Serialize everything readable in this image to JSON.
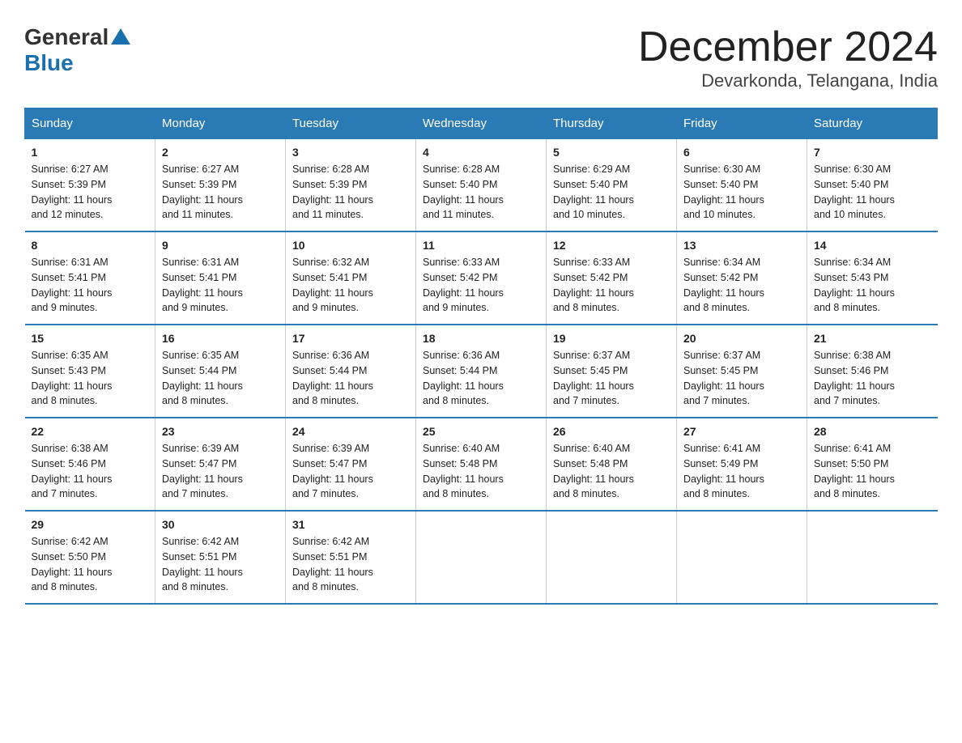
{
  "logo": {
    "general": "General",
    "blue": "Blue"
  },
  "title": {
    "month": "December 2024",
    "location": "Devarkonda, Telangana, India"
  },
  "days_of_week": [
    "Sunday",
    "Monday",
    "Tuesday",
    "Wednesday",
    "Thursday",
    "Friday",
    "Saturday"
  ],
  "weeks": [
    [
      {
        "day": "1",
        "sunrise": "6:27 AM",
        "sunset": "5:39 PM",
        "daylight": "11 hours and 12 minutes."
      },
      {
        "day": "2",
        "sunrise": "6:27 AM",
        "sunset": "5:39 PM",
        "daylight": "11 hours and 11 minutes."
      },
      {
        "day": "3",
        "sunrise": "6:28 AM",
        "sunset": "5:39 PM",
        "daylight": "11 hours and 11 minutes."
      },
      {
        "day": "4",
        "sunrise": "6:28 AM",
        "sunset": "5:40 PM",
        "daylight": "11 hours and 11 minutes."
      },
      {
        "day": "5",
        "sunrise": "6:29 AM",
        "sunset": "5:40 PM",
        "daylight": "11 hours and 10 minutes."
      },
      {
        "day": "6",
        "sunrise": "6:30 AM",
        "sunset": "5:40 PM",
        "daylight": "11 hours and 10 minutes."
      },
      {
        "day": "7",
        "sunrise": "6:30 AM",
        "sunset": "5:40 PM",
        "daylight": "11 hours and 10 minutes."
      }
    ],
    [
      {
        "day": "8",
        "sunrise": "6:31 AM",
        "sunset": "5:41 PM",
        "daylight": "11 hours and 9 minutes."
      },
      {
        "day": "9",
        "sunrise": "6:31 AM",
        "sunset": "5:41 PM",
        "daylight": "11 hours and 9 minutes."
      },
      {
        "day": "10",
        "sunrise": "6:32 AM",
        "sunset": "5:41 PM",
        "daylight": "11 hours and 9 minutes."
      },
      {
        "day": "11",
        "sunrise": "6:33 AM",
        "sunset": "5:42 PM",
        "daylight": "11 hours and 9 minutes."
      },
      {
        "day": "12",
        "sunrise": "6:33 AM",
        "sunset": "5:42 PM",
        "daylight": "11 hours and 8 minutes."
      },
      {
        "day": "13",
        "sunrise": "6:34 AM",
        "sunset": "5:42 PM",
        "daylight": "11 hours and 8 minutes."
      },
      {
        "day": "14",
        "sunrise": "6:34 AM",
        "sunset": "5:43 PM",
        "daylight": "11 hours and 8 minutes."
      }
    ],
    [
      {
        "day": "15",
        "sunrise": "6:35 AM",
        "sunset": "5:43 PM",
        "daylight": "11 hours and 8 minutes."
      },
      {
        "day": "16",
        "sunrise": "6:35 AM",
        "sunset": "5:44 PM",
        "daylight": "11 hours and 8 minutes."
      },
      {
        "day": "17",
        "sunrise": "6:36 AM",
        "sunset": "5:44 PM",
        "daylight": "11 hours and 8 minutes."
      },
      {
        "day": "18",
        "sunrise": "6:36 AM",
        "sunset": "5:44 PM",
        "daylight": "11 hours and 8 minutes."
      },
      {
        "day": "19",
        "sunrise": "6:37 AM",
        "sunset": "5:45 PM",
        "daylight": "11 hours and 7 minutes."
      },
      {
        "day": "20",
        "sunrise": "6:37 AM",
        "sunset": "5:45 PM",
        "daylight": "11 hours and 7 minutes."
      },
      {
        "day": "21",
        "sunrise": "6:38 AM",
        "sunset": "5:46 PM",
        "daylight": "11 hours and 7 minutes."
      }
    ],
    [
      {
        "day": "22",
        "sunrise": "6:38 AM",
        "sunset": "5:46 PM",
        "daylight": "11 hours and 7 minutes."
      },
      {
        "day": "23",
        "sunrise": "6:39 AM",
        "sunset": "5:47 PM",
        "daylight": "11 hours and 7 minutes."
      },
      {
        "day": "24",
        "sunrise": "6:39 AM",
        "sunset": "5:47 PM",
        "daylight": "11 hours and 7 minutes."
      },
      {
        "day": "25",
        "sunrise": "6:40 AM",
        "sunset": "5:48 PM",
        "daylight": "11 hours and 8 minutes."
      },
      {
        "day": "26",
        "sunrise": "6:40 AM",
        "sunset": "5:48 PM",
        "daylight": "11 hours and 8 minutes."
      },
      {
        "day": "27",
        "sunrise": "6:41 AM",
        "sunset": "5:49 PM",
        "daylight": "11 hours and 8 minutes."
      },
      {
        "day": "28",
        "sunrise": "6:41 AM",
        "sunset": "5:50 PM",
        "daylight": "11 hours and 8 minutes."
      }
    ],
    [
      {
        "day": "29",
        "sunrise": "6:42 AM",
        "sunset": "5:50 PM",
        "daylight": "11 hours and 8 minutes."
      },
      {
        "day": "30",
        "sunrise": "6:42 AM",
        "sunset": "5:51 PM",
        "daylight": "11 hours and 8 minutes."
      },
      {
        "day": "31",
        "sunrise": "6:42 AM",
        "sunset": "5:51 PM",
        "daylight": "11 hours and 8 minutes."
      },
      {
        "day": "",
        "sunrise": "",
        "sunset": "",
        "daylight": ""
      },
      {
        "day": "",
        "sunrise": "",
        "sunset": "",
        "daylight": ""
      },
      {
        "day": "",
        "sunrise": "",
        "sunset": "",
        "daylight": ""
      },
      {
        "day": "",
        "sunrise": "",
        "sunset": "",
        "daylight": ""
      }
    ]
  ],
  "labels": {
    "sunrise": "Sunrise:",
    "sunset": "Sunset:",
    "daylight": "Daylight:"
  }
}
